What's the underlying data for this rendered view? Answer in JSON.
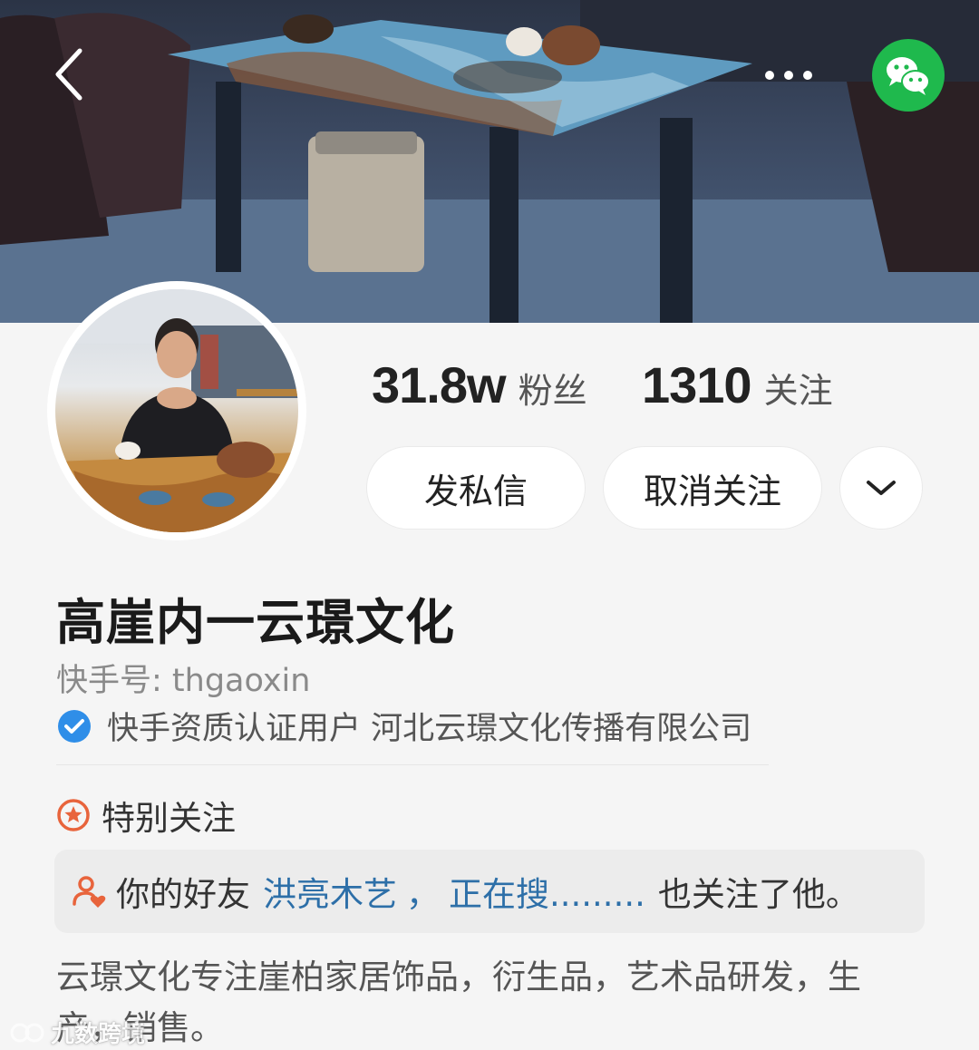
{
  "stats": {
    "followers_count": "31.8w",
    "followers_label": "粉丝",
    "following_count": "1310",
    "following_label": "关注"
  },
  "actions": {
    "message_label": "发私信",
    "unfollow_label": "取消关注"
  },
  "profile": {
    "name": "高崖内一云璟文化",
    "kuaishou_id": "快手号: thgaoxin",
    "verification": "快手资质认证用户 河北云璟文化传播有限公司"
  },
  "special_follow": {
    "label": "特别关注"
  },
  "friends": {
    "prefix": "你的好友",
    "friend_1": "洪亮木艺",
    "separator": "，",
    "friend_2": "正在搜.........",
    "suffix": "也关注了他。"
  },
  "bio": "云璟文化专注崖柏家居饰品，衍生品，艺术品研发，生产，销售。",
  "watermark": "九数跨境",
  "colors": {
    "wechat_green": "#1fb94d",
    "verify_blue": "#2f8ee8",
    "special_orange": "#e8643c",
    "friend_link_blue": "#2d6fa8"
  },
  "icons": {
    "back": "chevron-left-icon",
    "more": "more-dots-icon",
    "share": "wechat-icon",
    "dropdown": "chevron-down-icon",
    "verified": "check-badge-icon",
    "special": "star-circle-icon",
    "friends": "user-heart-icon"
  }
}
